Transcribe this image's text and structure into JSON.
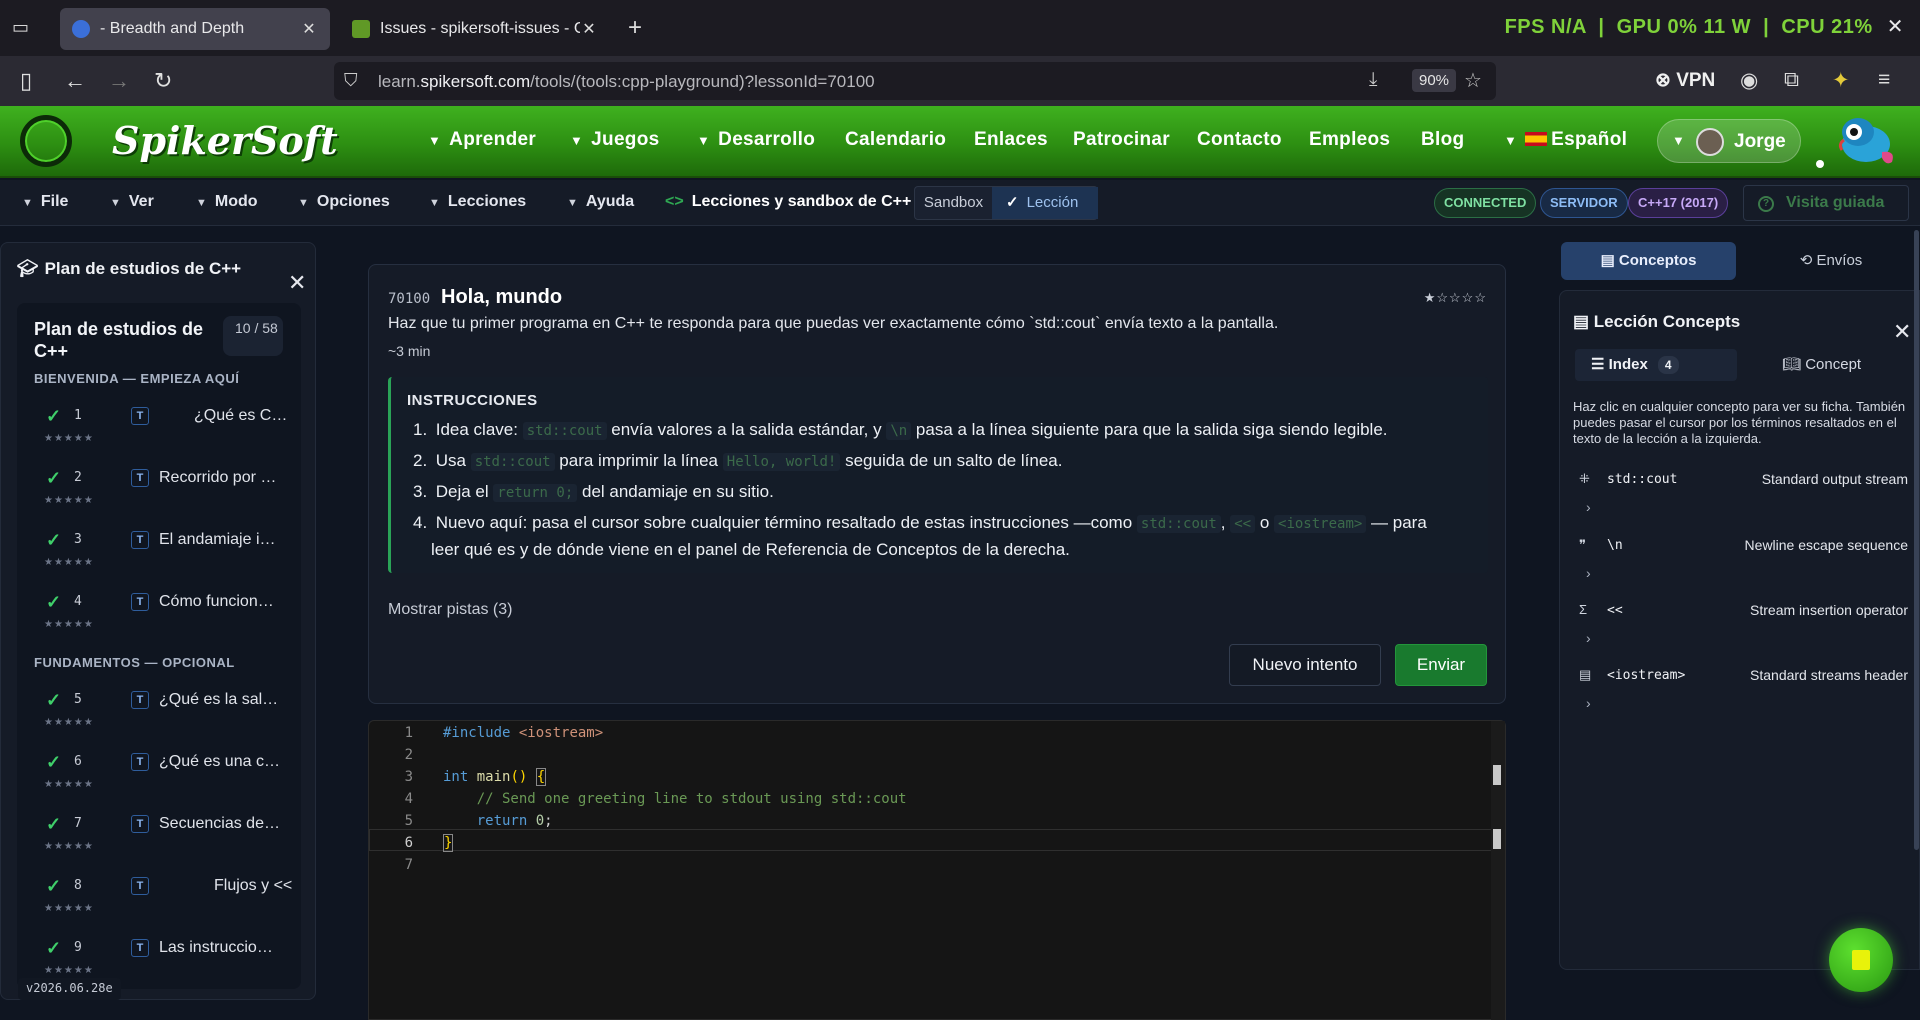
{
  "browser": {
    "tabs": [
      {
        "title": "- Breadth and Depth",
        "active": true
      },
      {
        "title": "Issues - spikersoft-issues - Gitea"
      }
    ],
    "url_prefix": "learn.",
    "url_domain": "spikersoft.com",
    "url_path": "/tools/(tools:cpp-playground)?lessonId=70100",
    "zoom": "90%",
    "vpn_label": "VPN",
    "hud": {
      "fps_label": "FPS",
      "fps_value": "N/A",
      "gpu_label": "GPU",
      "gpu_value": "0%",
      "watts": "11 W",
      "cpu_label": "CPU",
      "cpu_value": "21%"
    }
  },
  "site": {
    "brand": "SpikerSoft",
    "nav": [
      "Aprender",
      "Juegos",
      "Desarrollo",
      "Calendario",
      "Enlaces",
      "Patrocinar",
      "Contacto",
      "Empleos",
      "Blog"
    ],
    "language": "Español",
    "user": "Jorge"
  },
  "toolbar": {
    "menus": [
      "File",
      "Ver",
      "Modo",
      "Opciones",
      "Lecciones",
      "Ayuda"
    ],
    "breadcrumb": "Lecciones y sandbox de C++",
    "mode_sandbox": "Sandbox",
    "mode_lesson": "Lección",
    "badges": {
      "connected": "CONNECTED",
      "server": "SERVIDOR",
      "standard": "C++17 (2017)"
    },
    "guided_tour": "Visita guiada"
  },
  "sidebar": {
    "header": "Plan de estudios de C++",
    "card_title": "Plan de estudios de C++",
    "progress": "10 / 58",
    "section1": "BIENVENIDA — EMPIEZA AQUÍ",
    "section2": "FUNDAMENTOS — OPCIONAL",
    "type_badge": "T",
    "stars": "★★★★★",
    "lessons": [
      {
        "num": "1",
        "name": "¿Qué es C++?"
      },
      {
        "num": "2",
        "name": "Recorrido por …"
      },
      {
        "num": "3",
        "name": "El andamiaje i…"
      },
      {
        "num": "4",
        "name": "Cómo funcion…"
      },
      {
        "num": "5",
        "name": "¿Qué es la sali…"
      },
      {
        "num": "6",
        "name": "¿Qué es una c…"
      },
      {
        "num": "7",
        "name": "Secuencias de…"
      },
      {
        "num": "8",
        "name": "Flujos y <<"
      },
      {
        "num": "9",
        "name": "Las instruccio…"
      }
    ],
    "version": "v2026.06.28e"
  },
  "lesson": {
    "id": "70100",
    "title": "Hola, mundo",
    "stars": "★☆☆☆☆",
    "description": "Haz que tu primer programa en C++ te responda para que puedas ver exactamente cómo `std::cout` envía texto a la pantalla.",
    "time": "~3 min",
    "instructions_header": "INSTRUCCIONES",
    "steps": {
      "s1_num": "1.",
      "s1_a": "Idea clave:",
      "s1_code1": "std::cout",
      "s1_b": "envía valores a la salida estándar, y",
      "s1_code2": "\\n",
      "s1_c": "pasa a la línea siguiente para que la salida siga siendo legible.",
      "s2_num": "2.",
      "s2_a": "Usa",
      "s2_code1": "std::cout",
      "s2_b": "para imprimir la línea",
      "s2_code2": "Hello, world!",
      "s2_c": "seguida de un salto de línea.",
      "s3_num": "3.",
      "s3_a": "Deja el",
      "s3_code1": "return 0;",
      "s3_b": "del andamiaje en su sitio.",
      "s4_num": "4.",
      "s4_a": "Nuevo aquí: pasa el cursor sobre cualquier término resaltado de estas instrucciones —como",
      "s4_code1": "std::cout",
      "s4_comma": ",",
      "s4_code2": "<<",
      "s4_o": "o",
      "s4_code3": "<iostream>",
      "s4_b": "— para",
      "s4_line2": "leer qué es y de dónde viene en el panel de Referencia de Conceptos de la derecha."
    },
    "hints": "Mostrar pistas (3)",
    "retry": "Nuevo intento",
    "submit": "Enviar"
  },
  "editor": {
    "line_numbers": [
      "1",
      "2",
      "3",
      "4",
      "5",
      "6",
      "7"
    ],
    "l1_pp": "#include",
    "l1_hdr": "<iostream>",
    "l3_kw": "int",
    "l3_fn": "main",
    "l3_rest": "()",
    "l3_brace": "{",
    "l4": "    // Send one greeting line to stdout using std::cout",
    "l5_kw": "    return",
    "l5_num": "0",
    "l5_semi": ";",
    "l6": "}"
  },
  "right_panel": {
    "tab_concepts": "Conceptos",
    "tab_submissions": "Envíos",
    "header": "Lección Concepts",
    "sub_index": "Index",
    "sub_index_count": "4",
    "sub_concept": "Concept",
    "help": "Haz clic en cualquier concepto para ver su ficha. También puedes pasar el cursor por los términos resaltados en el texto de la lección a la izquierda.",
    "concepts": [
      {
        "icon": "⁜",
        "term": "std::cout",
        "def": "Standard output stream"
      },
      {
        "icon": "❞",
        "term": "\\n",
        "def": "Newline escape sequence"
      },
      {
        "icon": "Σ",
        "term": "<<",
        "def": "Stream insertion operator"
      },
      {
        "icon": "▤",
        "term": "<iostream>",
        "def": "Standard streams header"
      }
    ]
  },
  "colors": {
    "brand_green": "#2d8f12",
    "accent_green": "#197a2e",
    "connected": "#7fe0a2",
    "server": "#8dbcf5",
    "standard": "#c7a9f7"
  }
}
